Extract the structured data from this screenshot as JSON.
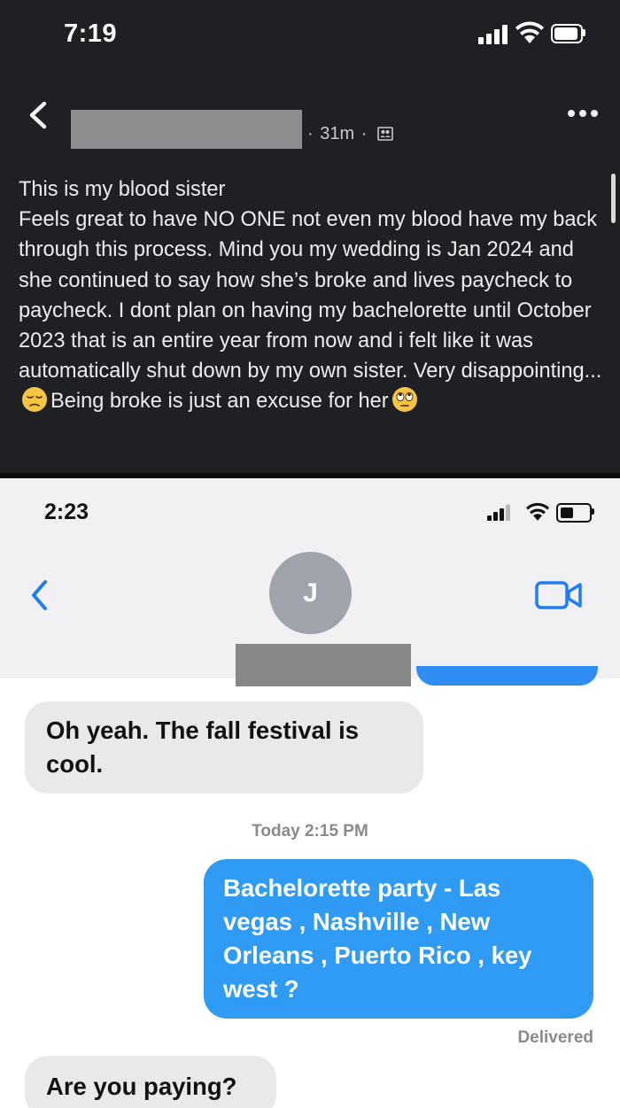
{
  "post_screen": {
    "status_time": "7:19",
    "meta": {
      "age": "31m",
      "separator": "·"
    },
    "paragraph_1": "This is my blood sister",
    "paragraph_2a": "Feels great to have NO ONE not even my blood have my back through this process. Mind you my wedding is Jan 2024 and she continued to say how she’s broke and lives paycheck to paycheck. I dont plan on having my bachelorette until October 2023 that is an entire year from now and i felt like it was automatically shut down by my own sister. Very disappointing...",
    "paragraph_2b": "Being broke is just an excuse for her",
    "emojis": [
      "pensive-face",
      "rolling-eyes-face"
    ],
    "colors": {
      "background": "#1f2023",
      "text": "#ececee"
    }
  },
  "imessage_screen": {
    "status_time": "2:23",
    "avatar_initial": "J",
    "messages": [
      {
        "direction": "incoming",
        "text": "Oh yeah. The fall festival is cool."
      },
      {
        "direction": "outgoing",
        "text": "Bachelorette party - Las vegas , Nashville , New Orleans , Puerto Rico , key west ?"
      },
      {
        "direction": "incoming",
        "text": "Are you paying?"
      }
    ],
    "timestamp": "Today 2:15 PM",
    "delivered_label": "Delivered",
    "colors": {
      "outgoing_bubble": "#2f9bf5",
      "incoming_bubble": "#e9e9eb",
      "accent": "#1f7cf2"
    }
  }
}
